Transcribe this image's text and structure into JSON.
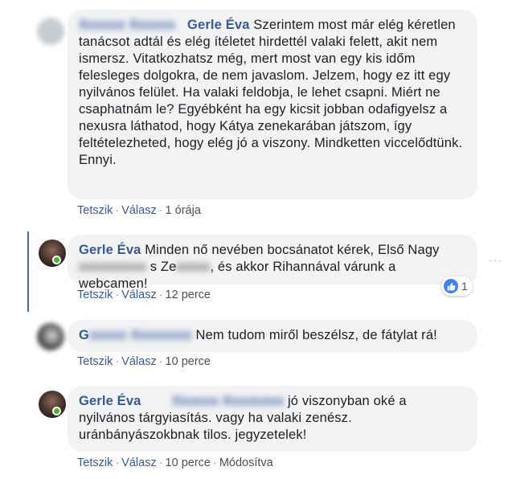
{
  "comments": [
    {
      "author": "Gerle Éva",
      "text": "Szerintem most már elég kéretlen tanácsot adtál és elég ítéletet hirdettél valaki felett, akit nem ismersz. Vitatkozhatsz még, mert most van egy kis időm felesleges dolgokra, de nem javaslom. Jelzem, hogy ez itt egy nyilvános felület. Ha valaki feldobja, le lehet csapni. Miért ne csaphatnám le? Egyébként ha egy kicsit jobban odafigyelsz a nexusra láthatod, hogy Kátya zenekarában játszom, így feltételezheted, hogy elég jó a viszony. Mindketten viccelődtünk. Ennyi.",
      "like": "Tetszik",
      "reply": "Válasz",
      "time": "1 órája"
    },
    {
      "author": "Gerle Éva",
      "text_a": "Minden nő nevében bocsánatot kérek, Első Nagy",
      "text_b": "s Ze",
      "text_c": ", és akkor Rihannával várunk a webcamen!",
      "like": "Tetszik",
      "reply": "Válasz",
      "time": "12 perce",
      "reaction_count": "1"
    },
    {
      "author": "G",
      "text": "Nem tudom miről beszélsz, de fátylat rá!",
      "like": "Tetszik",
      "reply": "Válasz",
      "time": "10 perce"
    },
    {
      "author": "Gerle Éva",
      "text": "jó viszonyban oké a nyilvános tárgyiasítás. vagy ha valaki zenész. uránbányászokbnak tilos. jegyzetelek!",
      "like": "Tetszik",
      "reply": "Válasz",
      "time": "10 perce",
      "edited": "Módosítva"
    }
  ],
  "more_icon": "···",
  "colors": {
    "link": "#385898",
    "bubble": "#f2f3f5",
    "thread": "#4267b2",
    "like": "#4080ff",
    "online": "#42b72a"
  }
}
